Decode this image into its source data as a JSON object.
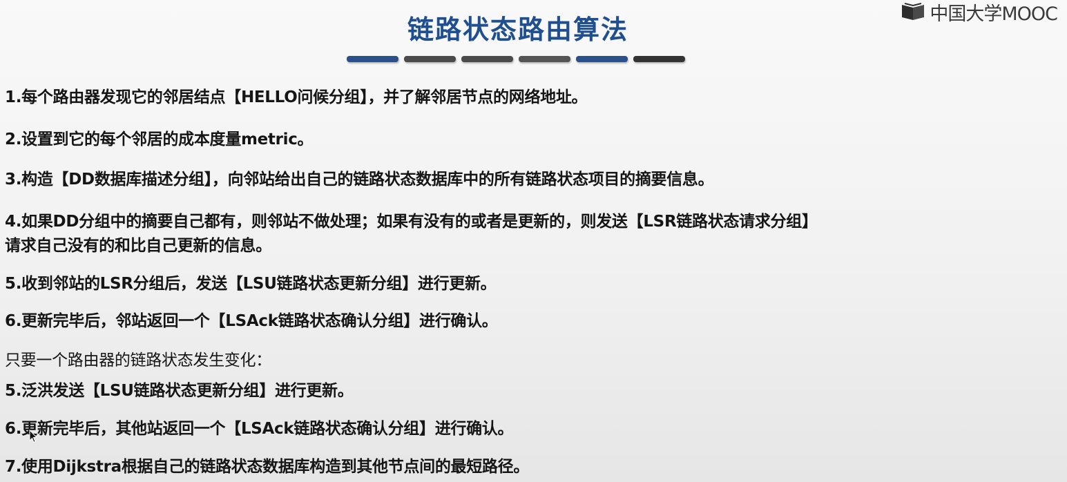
{
  "title": "链路状态路由算法",
  "logo": {
    "text": "中国大学MOOC"
  },
  "divider_colors": [
    "#2b5089",
    "#4a4a4a",
    "#4a4a4a",
    "#555555",
    "#2b5089",
    "#333333"
  ],
  "lines": [
    "1.每个路由器发现它的邻居结点【HELLO问候分组】，并了解邻居节点的网络地址。",
    "2.设置到它的每个邻居的成本度量metric。",
    "3.构造【DD数据库描述分组】，向邻站给出自己的链路状态数据库中的所有链路状态项目的摘要信息。",
    "4.如果DD分组中的摘要自己都有，则邻站不做处理；如果有没有的或者是更新的，则发送【LSR链路状态请求分组】",
    "请求自己没有的和比自己更新的信息。",
    "5.收到邻站的LSR分组后，发送【LSU链路状态更新分组】进行更新。",
    "6.更新完毕后，邻站返回一个【LSAck链路状态确认分组】进行确认。",
    "只要一个路由器的链路状态发生变化：",
    "5.泛洪发送【LSU链路状态更新分组】进行更新。",
    "6.更新完毕后，其他站返回一个【LSAck链路状态确认分组】进行确认。",
    "7.使用Dijkstra根据自己的链路状态数据库构造到其他节点间的最短路径。"
  ]
}
